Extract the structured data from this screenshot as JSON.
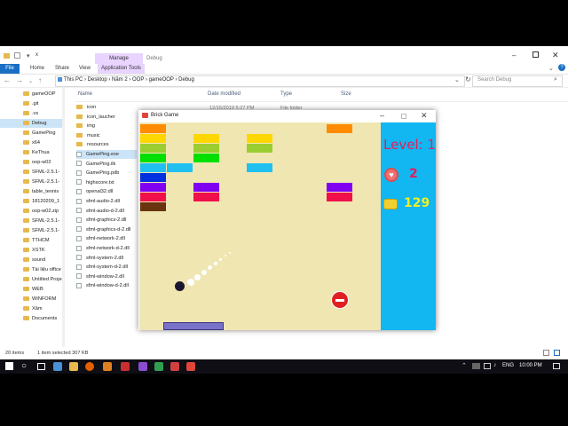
{
  "explorer": {
    "title_path": "x",
    "context_tab": "Manage",
    "context_label": "Debug",
    "ribbon_tabs": [
      "File",
      "Home",
      "Share",
      "View",
      "Application Tools"
    ],
    "breadcrumb": "This PC  ›  Desktop  ›  Năm 2  ›  OOP  ›  gameOOP  ›  Debug",
    "search_placeholder": "Search Debug",
    "columns": {
      "name": "Name",
      "date": "Date modified",
      "type": "Type",
      "size": "Size"
    },
    "partial_row": {
      "date": "12/15/2019 5:27 PM",
      "type": "File folder"
    },
    "tree": [
      {
        "label": "gameOOP",
        "selected": false
      },
      {
        "label": ".git",
        "selected": false
      },
      {
        "label": ".vs",
        "selected": false
      },
      {
        "label": "Debug",
        "selected": true
      },
      {
        "label": "GamePing",
        "selected": false
      },
      {
        "label": "x64",
        "selected": false
      },
      {
        "label": "KeThua",
        "selected": false
      },
      {
        "label": "oop-w02",
        "selected": false
      },
      {
        "label": "SFML-2.5.1-",
        "selected": false
      },
      {
        "label": "SFML-2.5.1-",
        "selected": false
      },
      {
        "label": "table_tennis",
        "selected": false
      },
      {
        "label": "18120209_1",
        "selected": false
      },
      {
        "label": "oop-w02.zip",
        "selected": false
      },
      {
        "label": "SFML-2.5.1-",
        "selected": false
      },
      {
        "label": "SFML-2.5.1-",
        "selected": false
      },
      {
        "label": "TTHCM",
        "selected": false
      },
      {
        "label": "XSTK",
        "selected": false
      },
      {
        "label": "sound",
        "selected": false
      },
      {
        "label": "Tài liệu office",
        "selected": false
      },
      {
        "label": "Untitled Project",
        "selected": false
      },
      {
        "label": "WEB",
        "selected": false
      },
      {
        "label": "WINFORM",
        "selected": false
      },
      {
        "label": "Xâm",
        "selected": false
      },
      {
        "label": "Documents",
        "selected": false
      }
    ],
    "files": [
      {
        "name": "icon",
        "kind": "folder",
        "selected": false
      },
      {
        "name": "icon_laucher",
        "kind": "folder",
        "selected": false
      },
      {
        "name": "img",
        "kind": "folder",
        "selected": false
      },
      {
        "name": "music",
        "kind": "folder",
        "selected": false
      },
      {
        "name": "resources",
        "kind": "folder",
        "selected": false
      },
      {
        "name": "GamePing.exe",
        "kind": "file",
        "selected": true
      },
      {
        "name": "GamePing.ilk",
        "kind": "file",
        "selected": false
      },
      {
        "name": "GamePing.pdb",
        "kind": "file",
        "selected": false
      },
      {
        "name": "highscore.txt",
        "kind": "file",
        "selected": false
      },
      {
        "name": "openal32.dll",
        "kind": "file",
        "selected": false
      },
      {
        "name": "sfml-audio-2.dll",
        "kind": "file",
        "selected": false
      },
      {
        "name": "sfml-audio-d-2.dll",
        "kind": "file",
        "selected": false
      },
      {
        "name": "sfml-graphics-2.dll",
        "kind": "file",
        "selected": false
      },
      {
        "name": "sfml-graphics-d-2.dll",
        "kind": "file",
        "selected": false
      },
      {
        "name": "sfml-network-2.dll",
        "kind": "file",
        "selected": false
      },
      {
        "name": "sfml-network-d-2.dll",
        "kind": "file",
        "selected": false
      },
      {
        "name": "sfml-system-2.dll",
        "kind": "file",
        "selected": false
      },
      {
        "name": "sfml-system-d-2.dll",
        "kind": "file",
        "selected": false
      },
      {
        "name": "sfml-window-2.dll",
        "kind": "file",
        "selected": false
      },
      {
        "name": "sfml-window-d-2.dll",
        "kind": "file",
        "selected": false
      }
    ],
    "status_items": "20 items",
    "status_selected": "1 item selected  307 KB"
  },
  "game": {
    "title": "Brick Game",
    "level_text": "Level: 1",
    "lives": "2",
    "score": "129",
    "colors": {
      "playfield": "#f0e6b2",
      "panel": "#12b6f0",
      "paddle": "#7a72c8"
    },
    "bricks": [
      {
        "col": 0,
        "row": 0,
        "color": "#ff8c00"
      },
      {
        "col": 0,
        "row": 1,
        "color": "#ffd700"
      },
      {
        "col": 0,
        "row": 2,
        "color": "#9acd32"
      },
      {
        "col": 0,
        "row": 3,
        "color": "#00e000"
      },
      {
        "col": 0,
        "row": 4,
        "color": "#20c0f0"
      },
      {
        "col": 0,
        "row": 5,
        "color": "#0030e0"
      },
      {
        "col": 0,
        "row": 6,
        "color": "#8000f0"
      },
      {
        "col": 0,
        "row": 7,
        "color": "#f0104a"
      },
      {
        "col": 0,
        "row": 8,
        "color": "#6a3410"
      },
      {
        "col": 1,
        "row": 4,
        "color": "#20c0f0"
      },
      {
        "col": 2,
        "row": 1,
        "color": "#ffd700"
      },
      {
        "col": 2,
        "row": 2,
        "color": "#9acd32"
      },
      {
        "col": 2,
        "row": 3,
        "color": "#00e000"
      },
      {
        "col": 2,
        "row": 6,
        "color": "#8000f0"
      },
      {
        "col": 2,
        "row": 7,
        "color": "#f0104a"
      },
      {
        "col": 4,
        "row": 1,
        "color": "#ffd700"
      },
      {
        "col": 4,
        "row": 2,
        "color": "#9acd32"
      },
      {
        "col": 4,
        "row": 4,
        "color": "#20c0f0"
      },
      {
        "col": 7,
        "row": 0,
        "color": "#ff8c00"
      },
      {
        "col": 7,
        "row": 6,
        "color": "#8000f0"
      },
      {
        "col": 7,
        "row": 7,
        "color": "#f0104a"
      }
    ]
  },
  "taskbar": {
    "lang": "ENG",
    "time": "10:00 PM"
  }
}
